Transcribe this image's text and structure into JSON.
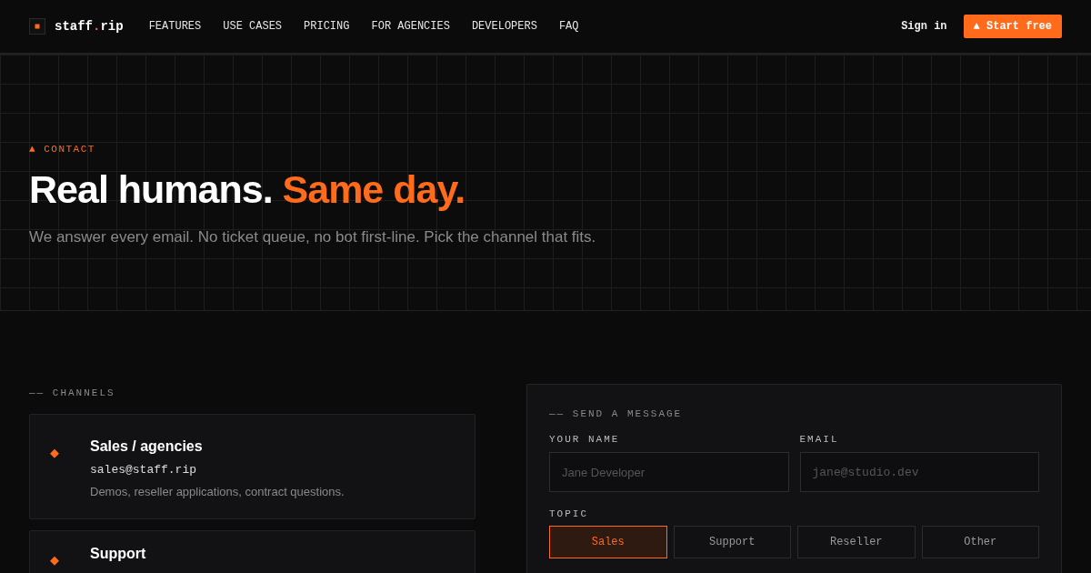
{
  "nav": {
    "logo": {
      "name": "staff",
      "dot": ".",
      "tld": "rip"
    },
    "links": [
      "FEATURES",
      "USE CASES",
      "PRICING",
      "FOR AGENCIES",
      "DEVELOPERS",
      "FAQ"
    ],
    "sign_in": "Sign in",
    "cta": "▲ Start free"
  },
  "hero": {
    "eyebrow": "▲ CONTACT",
    "title": "Real humans.",
    "title_accent": "Same day.",
    "subtitle": "We answer every email. No ticket queue, no bot first-line. Pick the channel that fits."
  },
  "channels": {
    "label": "—— CHANNELS",
    "items": [
      {
        "icon": "◆",
        "title": "Sales / agencies",
        "email": "sales@staff.rip",
        "description": "Demos, reseller applications, contract questions."
      },
      {
        "icon": "◆",
        "title": "Support"
      }
    ]
  },
  "form": {
    "label": "—— SEND A MESSAGE",
    "fields": [
      {
        "label": "YOUR NAME",
        "placeholder": "Jane Developer",
        "kind": "sans"
      },
      {
        "label": "EMAIL",
        "placeholder": "jane@studio.dev",
        "kind": "mono"
      }
    ],
    "topic_label": "TOPIC",
    "topics": [
      {
        "label": "Sales",
        "selected": true
      },
      {
        "label": "Support",
        "selected": false
      },
      {
        "label": "Reseller",
        "selected": false
      },
      {
        "label": "Other",
        "selected": false
      }
    ]
  }
}
